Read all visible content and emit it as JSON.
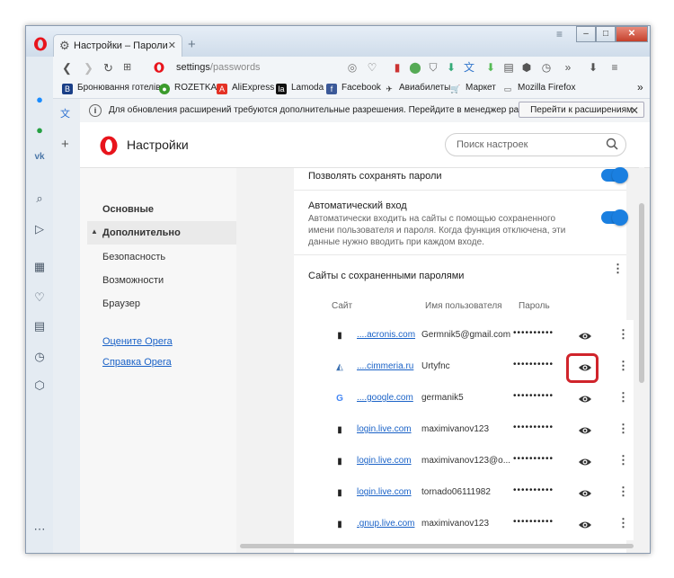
{
  "window": {
    "tab_title": "Настройки – Пароли",
    "new_tab": "+",
    "controls": {
      "minimize": "–",
      "maximize": "□",
      "close": "✕"
    }
  },
  "navbar": {
    "address_host": "settings",
    "address_path": "/passwords",
    "menu_more": "»",
    "menu_burger": "≡"
  },
  "bookmarks": [
    {
      "label": "Бронювання готелів",
      "icon": "booking-icon",
      "color": "#1a3f87"
    },
    {
      "label": "ROZETKA",
      "icon": "rozetka-icon",
      "color": "#3b9b2c"
    },
    {
      "label": "AliExpress",
      "icon": "aliexpress-icon",
      "color": "#e43225"
    },
    {
      "label": "Lamoda",
      "icon": "lamoda-icon",
      "color": "#111111"
    },
    {
      "label": "Facebook",
      "icon": "facebook-icon",
      "color": "#3b5998"
    },
    {
      "label": "Авиабилеты",
      "icon": "plane-icon",
      "color": "#1f1f1f"
    },
    {
      "label": "Маркет",
      "icon": "cart-icon",
      "color": "#1f1f1f"
    },
    {
      "label": "Mozilla Firefox",
      "icon": "folder-icon",
      "color": "#555555"
    }
  ],
  "bookmarks_more": "»",
  "infobar": {
    "message": "Для обновления расширений требуются дополнительные разрешения. Перейдите в менеджер расширений дл...",
    "button": "Перейти к расширениям",
    "close": "✕"
  },
  "settings": {
    "title": "Настройки",
    "search_placeholder": "Поиск настроек"
  },
  "nav": {
    "basic": "Основные",
    "advanced": "Дополнительно",
    "security": "Безопасность",
    "features": "Возможности",
    "browser": "Браузер",
    "rate": "Оцените Opera",
    "help": "Справка Opera"
  },
  "passwords": {
    "allow_save": "Позволять сохранять пароли",
    "auto_login": "Автоматический вход",
    "auto_login_desc": "Автоматически входить на сайты с помощью сохраненного имени пользователя и пароля. Когда функция отключена, эти данные нужно вводить при каждом входе.",
    "saved_title": "Сайты с сохраненными паролями",
    "col_site": "Сайт",
    "col_user": "Имя пользователя",
    "col_pass": "Пароль",
    "rows": [
      {
        "site": "....acronis.com",
        "user": "Germnik5@gmail.com",
        "password": "••••••••••",
        "icon": "doc-icon"
      },
      {
        "site": "....cimmeria.ru",
        "user": "Urtyfnc",
        "password": "••••••••••",
        "icon": "cimmeria-icon"
      },
      {
        "site": "....google.com",
        "user": "germanik5",
        "password": "••••••••••",
        "icon": "google-icon"
      },
      {
        "site": "login.live.com",
        "user": "maximivanov123",
        "password": "••••••••••",
        "icon": "doc-icon"
      },
      {
        "site": "login.live.com",
        "user": "maximivanov123@o...",
        "password": "••••••••••",
        "icon": "doc-icon"
      },
      {
        "site": "login.live.com",
        "user": "tornado06111982",
        "password": "••••••••••",
        "icon": "doc-icon"
      },
      {
        "site": ".gnup.live.com",
        "user": "maximivanov123",
        "password": "••••••••••",
        "icon": "doc-icon"
      }
    ]
  }
}
